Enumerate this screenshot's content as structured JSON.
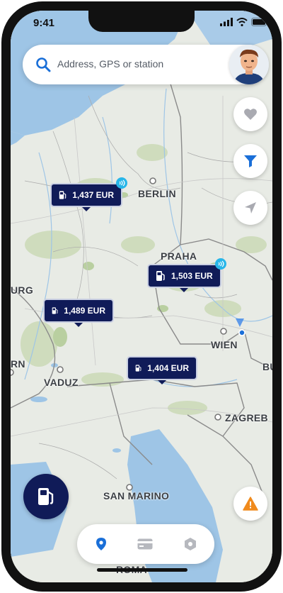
{
  "status_bar": {
    "time": "9:41"
  },
  "search": {
    "placeholder": "Address, GPS or station"
  },
  "map": {
    "cities": [
      {
        "id": "berlin",
        "label": "BERLIN"
      },
      {
        "id": "praha",
        "label": "PRAHA"
      },
      {
        "id": "wien",
        "label": "WIEN"
      },
      {
        "id": "vaduz",
        "label": "VADUZ"
      },
      {
        "id": "zagreb",
        "label": "ZAGREB"
      },
      {
        "id": "san-marino",
        "label": "SAN MARINO"
      },
      {
        "id": "roma",
        "label": "ROMA"
      },
      {
        "id": "burg",
        "label": "URG"
      },
      {
        "id": "bern",
        "label": "RN"
      },
      {
        "id": "bu",
        "label": "BU"
      }
    ],
    "stations": [
      {
        "price": "1,437 EUR",
        "nfc": true
      },
      {
        "price": "1,503 EUR",
        "nfc": true
      },
      {
        "price": "1,489 EUR",
        "nfc": false
      },
      {
        "price": "1,404 EUR",
        "nfc": false
      }
    ]
  },
  "colors": {
    "brand": "#101b58",
    "accent": "#1a6fd8",
    "nfc": "#27b6e9",
    "warning": "#f08a1c",
    "favorite": "#a9aab1"
  },
  "icons": {
    "search": "search-icon",
    "favorite": "heart-icon",
    "filter": "filter-icon",
    "locate": "navigation-arrow-icon",
    "warning": "warning-icon",
    "fuel": "fuel-pump-icon",
    "tab_map": "map-pin-icon",
    "tab_card": "card-icon",
    "tab_more": "hexagon-icon"
  }
}
